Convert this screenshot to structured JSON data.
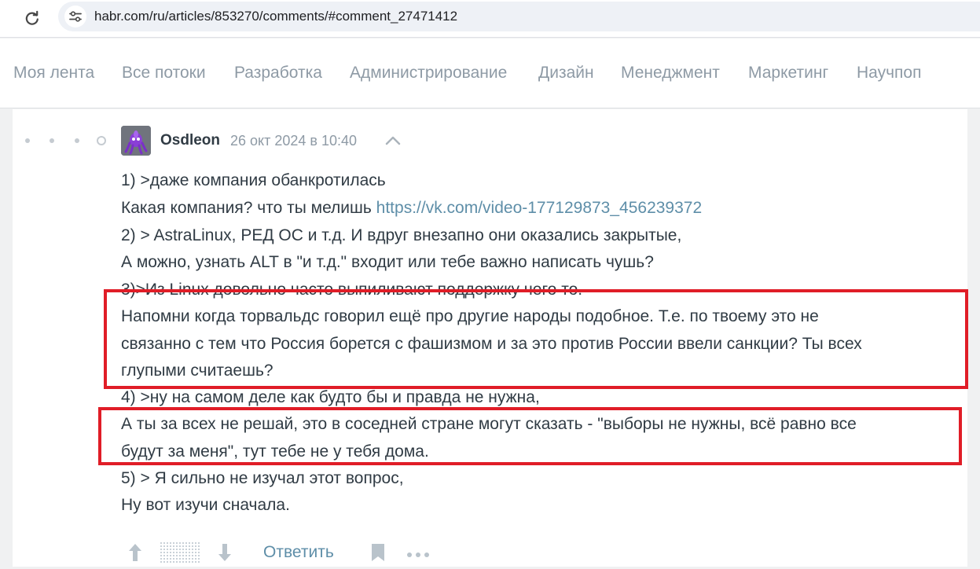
{
  "browser": {
    "url": "habr.com/ru/articles/853270/comments/#comment_27471412"
  },
  "nav": {
    "items": [
      "Моя лента",
      "Все потоки",
      "Разработка",
      "Администрирование",
      "Дизайн",
      "Менеджмент",
      "Маркетинг",
      "Научпоп"
    ]
  },
  "comment": {
    "author": "Osdleon",
    "date": "26 окт 2024 в 10:40",
    "lines": {
      "l1": "1) >даже компания обанкротилась",
      "l2_prefix": "Какая компания? что ты мелишь ",
      "l2_link": "https://vk.com/video-177129873_456239372",
      "l3": "2) > AstraLinux, РЕД ОС и т.д. И вдруг внезапно они оказались закрытые,",
      "l4": "А можно, узнать ALT в \"и т.д.\" входит или тебе важно написать чушь?",
      "l5": "3)>Из Linux довольно часто выпиливают поддержку чего то.",
      "l6": "Напомни когда торвальдс говорил ещё про другие народы подобное. Т.е. по твоему это не",
      "l7": "связанно с тем что Россия борется с фашизмом и за это против России ввели санкции? Ты всех",
      "l8": "глупыми считаешь?",
      "l9": "4) >ну на самом деле как будто бы и правда не нужна,",
      "l10": "А ты за всех не решай, это в соседней стране могут сказать - \"выборы не нужны, всё равно все",
      "l11": "будут за меня\", тут тебе не у тебя дома.",
      "l12": "5) > Я сильно не изучал этот вопрос,",
      "l13": "Ну вот изучи сначала."
    },
    "reply_label": "Ответить"
  },
  "colors": {
    "highlight": "#e01d27",
    "link": "#5e8ea8",
    "text": "#303b44",
    "muted": "#8e9aa5"
  }
}
